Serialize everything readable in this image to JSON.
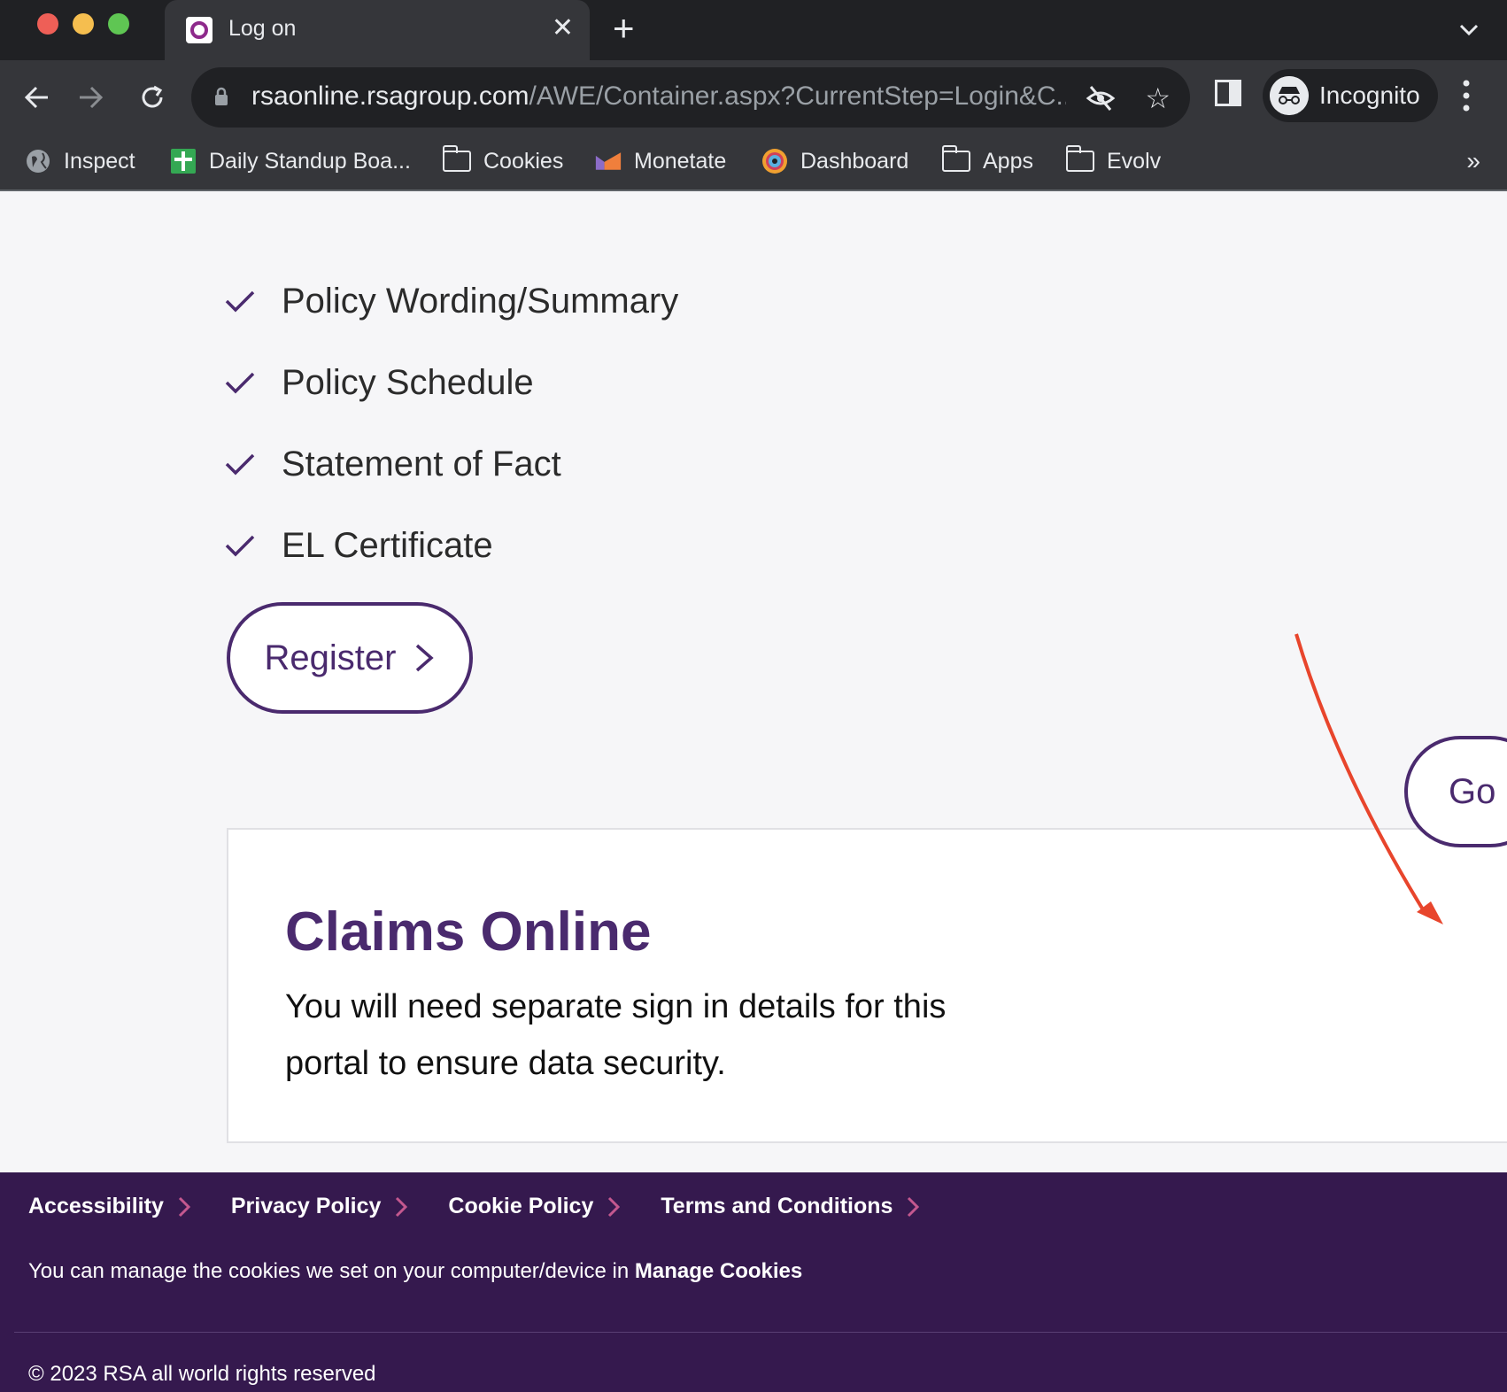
{
  "browser": {
    "tab_title": "Log on",
    "url_domain": "rsaonline.rsagroup.com",
    "url_path": "/AWE/Container.aspx?CurrentStep=Login&C...",
    "profile_label": "Incognito",
    "bookmarks": [
      {
        "label": "Inspect",
        "icon": "globe-icon"
      },
      {
        "label": "Daily Standup Boa...",
        "icon": "sheets-icon"
      },
      {
        "label": "Cookies",
        "icon": "folder-icon"
      },
      {
        "label": "Monetate",
        "icon": "monetate-icon"
      },
      {
        "label": "Dashboard",
        "icon": "dashboard-icon"
      },
      {
        "label": "Apps",
        "icon": "folder-icon"
      },
      {
        "label": "Evolv",
        "icon": "folder-icon"
      }
    ],
    "more_bookmarks": "»"
  },
  "page": {
    "checklist": [
      "Policy Wording/Summary",
      "Policy Schedule",
      "Statement of Fact",
      "EL Certificate"
    ],
    "register_label": "Register",
    "claims": {
      "title": "Claims Online",
      "description": "You will need separate sign in details for this portal to ensure data security.",
      "go_label": "Go"
    }
  },
  "footer": {
    "links": [
      "Accessibility",
      "Privacy Policy",
      "Cookie Policy",
      "Terms and Conditions"
    ],
    "cookie_text": "You can manage the cookies we set on your computer/device in ",
    "cookie_link": "Manage Cookies",
    "copyright": "© 2023 RSA all world rights reserved"
  },
  "colors": {
    "brand_purple": "#4a2a6e",
    "footer_bg": "#35194e",
    "accent_pink": "#c4588f",
    "annotation_red": "#e8452c"
  }
}
